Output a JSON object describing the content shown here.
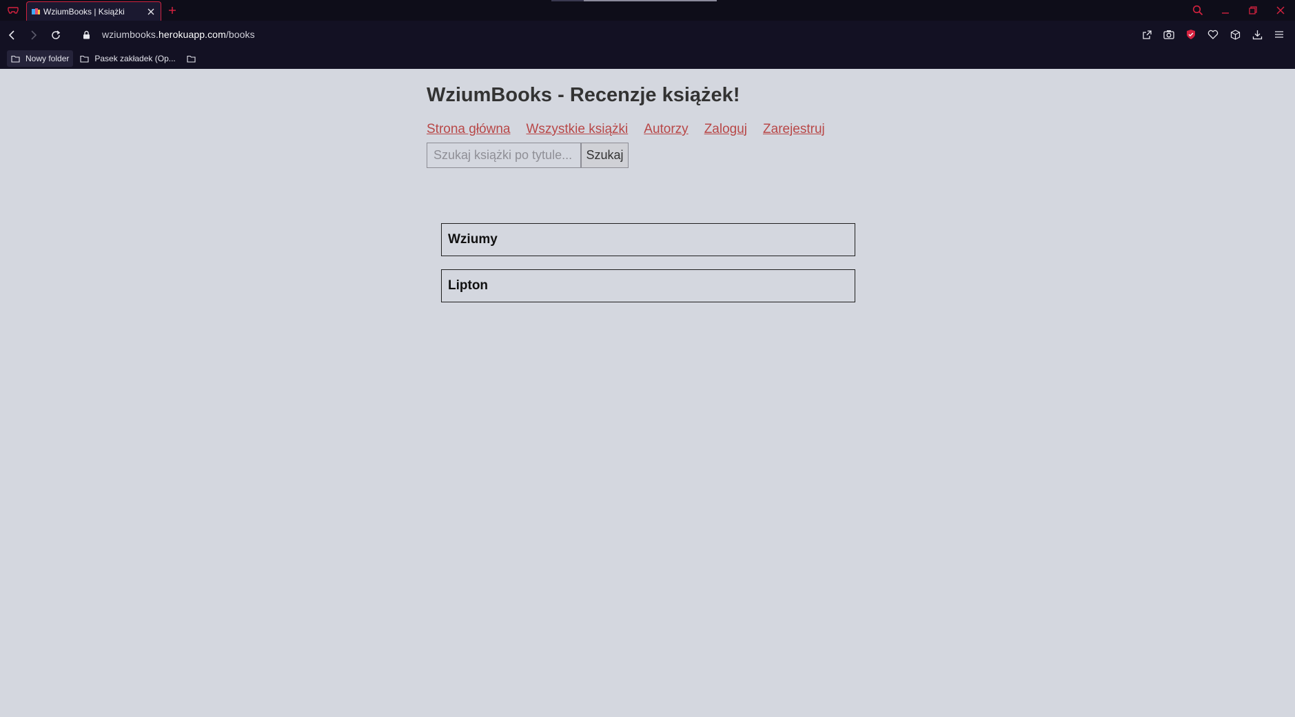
{
  "browser": {
    "tab": {
      "title": "WziumBooks | Książki"
    },
    "url": {
      "prefix": "wziumbooks.",
      "host": "herokuapp.com",
      "path": "/books"
    },
    "bookmarks": [
      {
        "label": "Nowy folder",
        "icon": "folder-icon"
      },
      {
        "label": "Pasek zakładek (Op...",
        "icon": "folder-icon"
      },
      {
        "label": "",
        "icon": "folder-icon"
      }
    ],
    "accent_color": "#d4223f"
  },
  "site": {
    "title": "WziumBooks - Recenzje książek!",
    "nav": [
      {
        "label": "Strona główna"
      },
      {
        "label": "Wszystkie książki"
      },
      {
        "label": "Autorzy"
      },
      {
        "label": "Zaloguj"
      },
      {
        "label": "Zarejestruj"
      }
    ],
    "search": {
      "placeholder": "Szukaj książki po tytule...",
      "value": "",
      "button_label": "Szukaj"
    },
    "books": [
      {
        "title": "Wziumy"
      },
      {
        "title": "Lipton"
      }
    ],
    "link_color": "#b84747",
    "background_color": "#d4d7df"
  }
}
